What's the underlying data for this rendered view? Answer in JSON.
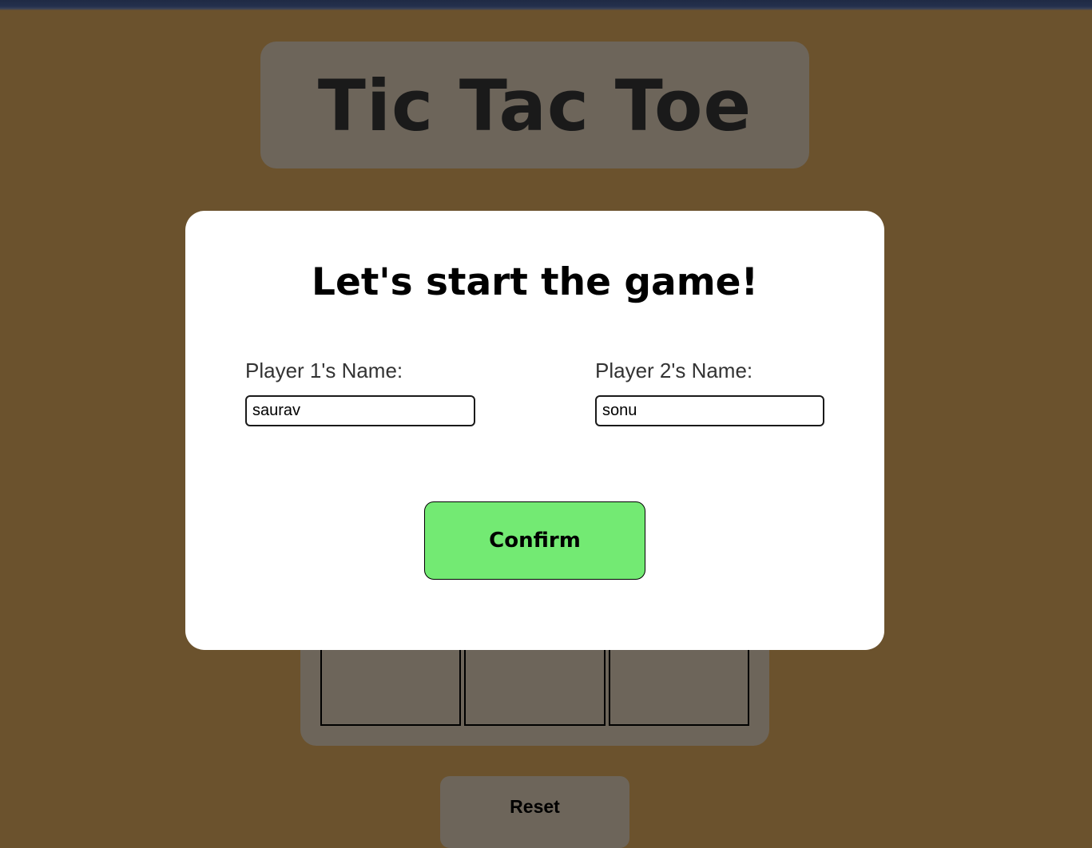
{
  "game": {
    "title": "Tic Tac Toe",
    "reset_label": "Reset"
  },
  "modal": {
    "heading": "Let's start the game!",
    "player1": {
      "label": "Player 1's Name:",
      "value": "saurav"
    },
    "player2": {
      "label": "Player 2's Name:",
      "value": "sonu"
    },
    "confirm_label": "Confirm"
  },
  "colors": {
    "background": "#6b522d",
    "panel": "#6d655a",
    "confirm": "#73ea73",
    "modal": "#ffffff"
  }
}
